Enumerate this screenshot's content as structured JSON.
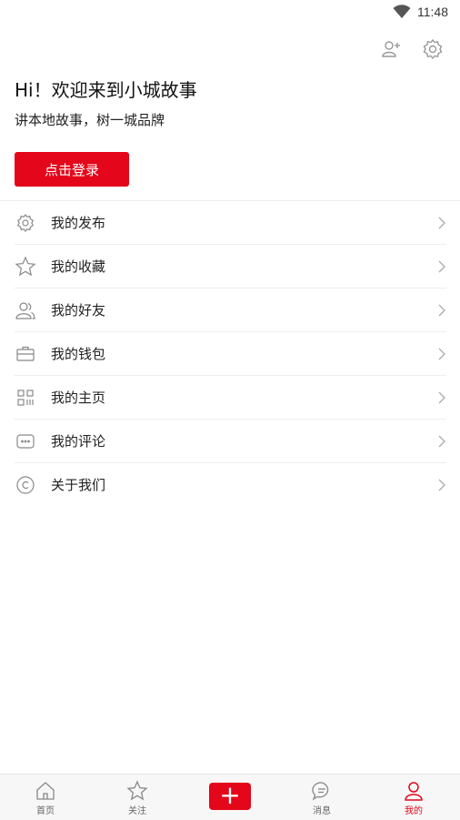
{
  "status_bar": {
    "time": "11:48",
    "wifi_icon": "wifi-icon"
  },
  "header": {
    "add_friend_icon": "add-friend-icon",
    "settings_icon": "settings-icon",
    "greeting": "Hi！欢迎来到小城故事",
    "slogan": "讲本地故事，树一城品牌",
    "login_label": "点击登录"
  },
  "menu": {
    "items": [
      {
        "label": "我的发布",
        "icon": "gear-icon"
      },
      {
        "label": "我的收藏",
        "icon": "star-icon"
      },
      {
        "label": "我的好友",
        "icon": "users-icon"
      },
      {
        "label": "我的钱包",
        "icon": "wallet-icon"
      },
      {
        "label": "我的主页",
        "icon": "qr-grid-icon"
      },
      {
        "label": "我的评论",
        "icon": "comment-icon"
      },
      {
        "label": "关于我们",
        "icon": "copyright-icon"
      }
    ]
  },
  "tabbar": {
    "accent_color": "#e4061a",
    "tabs": [
      {
        "label": "首页",
        "icon": "home-icon"
      },
      {
        "label": "关注",
        "icon": "star-icon"
      },
      {
        "label": "",
        "icon": "plus-icon"
      },
      {
        "label": "消息",
        "icon": "message-icon"
      },
      {
        "label": "我的",
        "icon": "user-icon"
      }
    ],
    "add_symbol": "+"
  }
}
